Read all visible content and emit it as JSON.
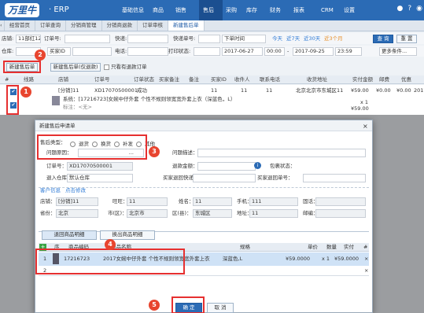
{
  "app": {
    "logo": "万里牛",
    "name": "· ERP"
  },
  "nav": {
    "items": [
      "基础信息",
      "商品",
      "销售",
      "售后",
      "采购",
      "库存",
      "财务",
      "报表",
      "CRM",
      "设置"
    ]
  },
  "tabs": [
    "经营首页",
    "订单查询",
    "分销商管理",
    "分销商退款",
    "订单审核",
    "新建售后单"
  ],
  "filters": {
    "row1": {
      "store_label": "店铺:",
      "store_value": "11部红12",
      "order_label": "订单号:",
      "express_label": "快递:",
      "express_no_label": "快递单号:",
      "time_type": "下单时间",
      "today": "今天",
      "d7": "近7天",
      "d30": "近30天",
      "d3m": "近3个月",
      "search_btn": "查 询",
      "reset_btn": "重 置"
    },
    "row2": {
      "warehouse_label": "仓库:",
      "warehouse_value": "买家ID",
      "phone_label": "电话:",
      "print_label": "打印状态:",
      "date_from": "2017-06-27",
      "time_from": "00:00",
      "date_to": "2017-09-25",
      "time_to": "23:59",
      "more": "更多条件..."
    }
  },
  "actions": {
    "new_aftersale": "新建售后单",
    "new_aftersale_goods": "新建售后单(仅退款)",
    "only_refund": "只看有退款订单"
  },
  "table": {
    "headers": [
      "#",
      "线路",
      "店铺",
      "订单号",
      "订单状态",
      "买家备注",
      "备注",
      "买家ID",
      "收件人",
      "联系电话",
      "收货地址",
      "实付金额",
      "邮费",
      "优惠"
    ],
    "row": {
      "shop": "[分销]11",
      "order_no": "XD17070500001",
      "status": "成功",
      "buyer_id": "11",
      "receiver": "11",
      "phone": "11",
      "address": "北京北京市东城区11",
      "paid": "¥59.00",
      "postage": "¥0.00",
      "discount": "¥0.00",
      "date": "2017/0"
    },
    "detail": {
      "text": "系统：[17216723]女婉中仔外套 个性不规则领宽宽外套上衣（深蓝色，L）",
      "note": "标注：<无>",
      "qty": "x 1",
      "amount": "¥59.00"
    }
  },
  "modal": {
    "title": "新建售后申请单",
    "type_label": "售后类型：",
    "types": [
      "退货",
      "换货",
      "补发",
      "其他"
    ],
    "reason_label": "问题原因：",
    "reason_value": "...",
    "desc_label": "问题描述：",
    "order_label": "订单号：",
    "order_value": "XD17070500001",
    "refund_label": "退款金额：",
    "pkg_label": "包裹状态：",
    "return_wh_label": "退入仓库：",
    "return_wh_value": "默认仓库",
    "return_express_label": "买家退回快递：",
    "return_express_no_label": "买家退回单号：",
    "customer_label": "客户信息",
    "customer_edit": "点击修改",
    "shop_label": "店铺：",
    "shop_value": "[分销]11",
    "nick_label": "旺旺：",
    "nick_value": "11",
    "name_label": "姓名：",
    "name_value": "11",
    "mobile_label": "手机：",
    "mobile_value": "111",
    "tel_label": "固话：",
    "tel_value": "",
    "prov_label": "省份：",
    "prov_value": "北京",
    "city_label": "市(区)：",
    "city_value": "北京市",
    "dist_label": "区(县)：",
    "dist_value": "东城区",
    "addr_label": "地址：",
    "addr_value": "11",
    "zip_label": "邮编：",
    "zip_value": "",
    "tab1": "退回商品明细",
    "tab2": "换出商品明细",
    "grid_headers": [
      "序",
      "商品编码",
      "商品名称",
      "规格",
      "单价",
      "数量",
      "实付",
      "#"
    ],
    "grid_row": {
      "idx": "1",
      "code": "17216723",
      "name": "2017女婉中仔外套 个性不规则领宽宽外套上衣",
      "spec": "深蓝色,L",
      "price": "¥59.0000",
      "qty": "x 1",
      "paid": "¥59.0000",
      "del": "×"
    },
    "grid_row2": {
      "idx": "2",
      "del": "×"
    },
    "ok": "确 定",
    "cancel": "取 消"
  },
  "callouts": [
    "1",
    "2",
    "3",
    "4",
    "5"
  ],
  "colors": {
    "brand": "#2b6bb5",
    "accent_red": "#e63030"
  }
}
